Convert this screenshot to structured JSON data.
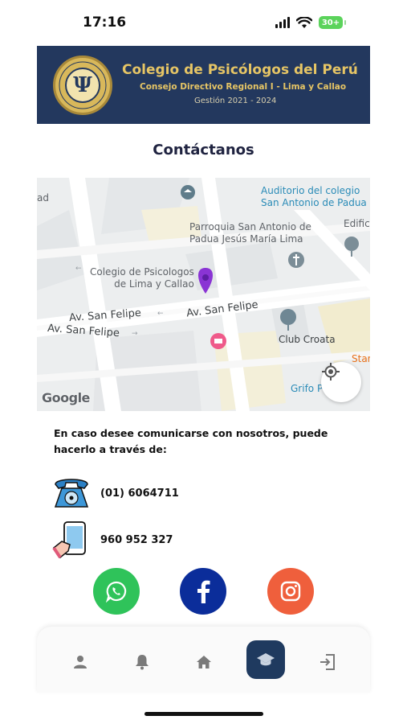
{
  "status_bar": {
    "time": "17:16",
    "battery": "30+"
  },
  "banner": {
    "title": "Colegio de Psicólogos del Perú",
    "subtitle": "Consejo Directivo Regional I - Lima y Callao",
    "period": "Gestión 2021 - 2024",
    "seal_text": "COLEGIO DE PSICÓLOGOS DEL PERÚ · CDR-I · 2021-2024"
  },
  "page_title": "Contáctanos",
  "map": {
    "labels": {
      "auditorio": "Auditorio del colegio\nSan Antonio de Padua",
      "parroquia": "Parroquia San Antonio de\nPadua Jesús María Lima",
      "colegio": "Colegio de Psicologos\nde Lima y Callao",
      "edificio": "Edifici",
      "club": "Club Croata",
      "grifo": "Grifo P",
      "star": "Star",
      "ad": "ad",
      "road1": "Av. San Felipe",
      "road2": "Av. San Felipe",
      "road3": "Av. San Felipe",
      "google": "Google"
    }
  },
  "contact": {
    "intro": "En caso desee comunicarse con nosotros, puede hacerlo a través de:",
    "phone": "(01) 6064711",
    "mobile": "960 952 327"
  },
  "socials": [
    {
      "name": "WhatsApp",
      "color": "#2fc35a"
    },
    {
      "name": "Facebook",
      "color": "#0b2d9a"
    },
    {
      "name": "Instagram",
      "color": "#ef5f3c"
    }
  ],
  "nav": {
    "items": [
      "profile",
      "notifications",
      "home",
      "education",
      "logout"
    ],
    "active": "education"
  },
  "colors": {
    "banner_bg": "#23385e",
    "banner_gold": "#e6c565",
    "nav_active": "#1f3a5f"
  }
}
